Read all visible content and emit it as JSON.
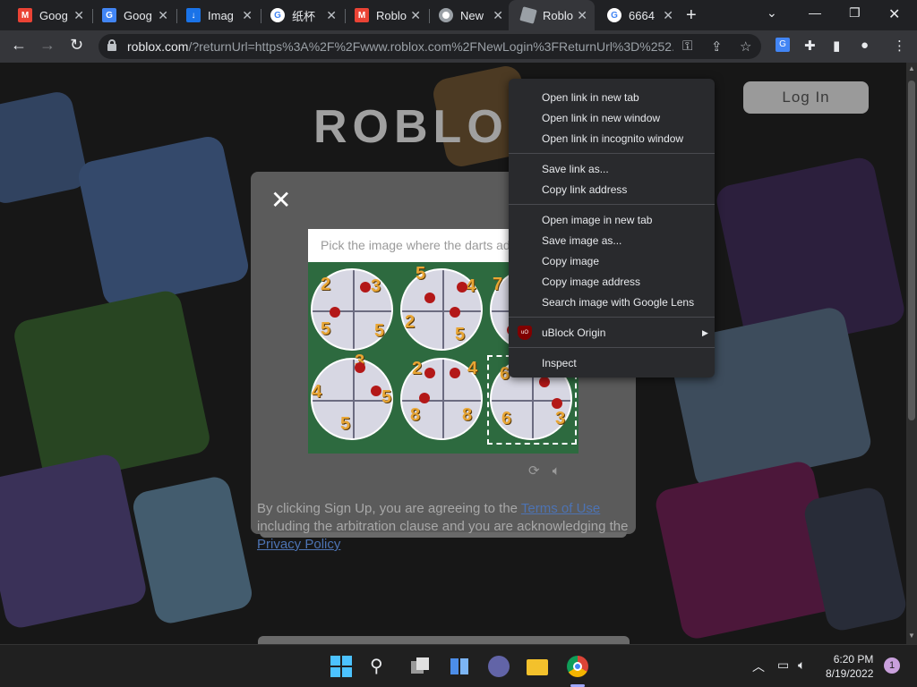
{
  "tabs": [
    {
      "title": "Goog",
      "favicon": "gmail-icon",
      "color": "#ea4335"
    },
    {
      "title": "Goog",
      "favicon": "google-translate-icon",
      "color": "#4285f4"
    },
    {
      "title": "Imag",
      "favicon": "download-icon",
      "color": "#1a73e8"
    },
    {
      "title": "纸杯",
      "favicon": "google-icon",
      "color": "#ffffff"
    },
    {
      "title": "Roblo",
      "favicon": "gmail-icon",
      "color": "#ea4335"
    },
    {
      "title": "New",
      "favicon": "chrome-icon",
      "color": "#ffffff"
    },
    {
      "title": "Roblo",
      "favicon": "roblox-icon",
      "color": "#9aa0a6",
      "active": true
    },
    {
      "title": "6664",
      "favicon": "google-icon",
      "color": "#ffffff"
    }
  ],
  "address": {
    "domain": "roblox.com",
    "rest": "/?returnUrl=https%3A%2F%2Fwww.roblox.com%2FNewLogin%3FReturnUrl%3D%252..."
  },
  "page": {
    "logo_text": "ROBLOX",
    "login_label": "Log In",
    "captcha": {
      "prompt": "Pick the image where the darts ad",
      "cells": [
        {
          "numbers": [
            "2",
            "3",
            "5",
            "5"
          ]
        },
        {
          "numbers": [
            "5",
            "4",
            "2",
            "5"
          ]
        },
        {
          "numbers": [
            "7"
          ]
        },
        {
          "numbers": [
            "3",
            "4",
            "5",
            "5"
          ]
        },
        {
          "numbers": [
            "2",
            "4",
            "8",
            "8"
          ]
        },
        {
          "numbers": [
            "6",
            "6",
            "3"
          ]
        }
      ]
    },
    "terms": {
      "part1": "By clicking Sign Up, you are agreeing to the ",
      "terms_link": "Terms of Use",
      "part2": " including the arbitration clause and you are acknowledging the ",
      "privacy_link": "Privacy Policy"
    }
  },
  "context_menu": {
    "group1": [
      "Open link in new tab",
      "Open link in new window",
      "Open link in incognito window"
    ],
    "group2": [
      "Save link as...",
      "Copy link address"
    ],
    "group3": [
      "Open image in new tab",
      "Save image as...",
      "Copy image",
      "Copy image address",
      "Search image with Google Lens"
    ],
    "extension": "uBlock Origin",
    "inspect": "Inspect"
  },
  "taskbar": {
    "time": "6:20 PM",
    "date": "8/19/2022",
    "notifications": "1"
  }
}
